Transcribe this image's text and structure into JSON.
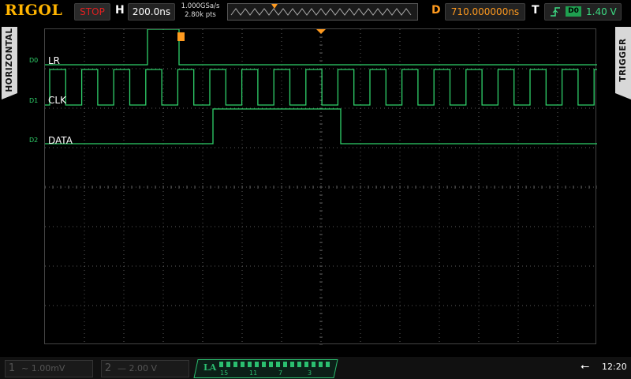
{
  "brand": "RIGOL",
  "run_state": "STOP",
  "horizontal": {
    "letter": "H",
    "timebase": "200.0ns",
    "sample_rate": "1.000GSa/s",
    "memory_depth": "2.80k pts"
  },
  "delay": {
    "letter": "D",
    "value": "710.000000ns"
  },
  "trigger": {
    "letter": "T",
    "source": "D0",
    "level": "1.40 V"
  },
  "side_tabs": {
    "left": "HORIZONTAL",
    "right": "TRIGGER"
  },
  "channels": [
    {
      "tag": "D0",
      "label": "LR"
    },
    {
      "tag": "D1",
      "label": "CLK"
    },
    {
      "tag": "D2",
      "label": "DATA"
    }
  ],
  "bottom": {
    "ch1": {
      "num": "1",
      "value": "~ 1.00mV"
    },
    "ch2": {
      "num": "2",
      "value": "— 2.00 V"
    },
    "la": {
      "label": "LA",
      "numbers": [
        "15",
        "11",
        "7",
        "3"
      ]
    },
    "clock": "12:20"
  },
  "colors": {
    "trace": "#2fd06a",
    "trigger": "#ff9a1f",
    "grid": "#5a5a5a"
  },
  "icons": {
    "usb": "usb-icon",
    "trigger_edge": "rising-edge-icon"
  }
}
